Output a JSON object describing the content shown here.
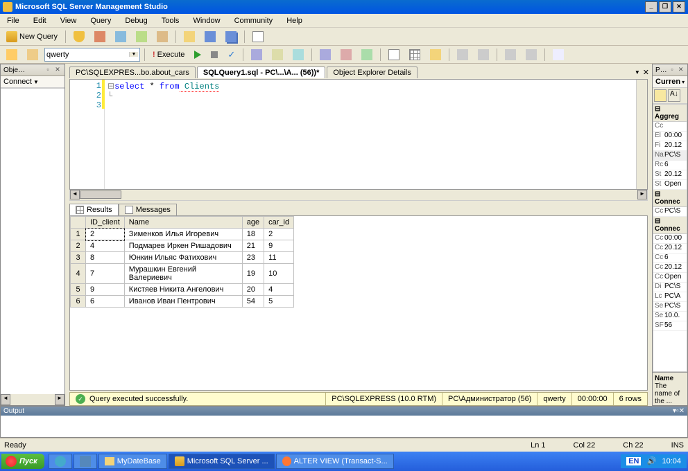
{
  "title": "Microsoft SQL Server Management Studio",
  "menu": [
    "File",
    "Edit",
    "View",
    "Query",
    "Debug",
    "Tools",
    "Window",
    "Community",
    "Help"
  ],
  "toolbar1": {
    "newquery": "New Query"
  },
  "toolbar2": {
    "database": "qwerty",
    "execute": "Execute"
  },
  "leftpanel": {
    "title": "Obje…",
    "connect": "Connect"
  },
  "tabs": [
    "PC\\SQLEXPRES...bo.about_cars",
    "SQLQuery1.sql - PC\\...\\А... (56))*",
    "Object Explorer Details"
  ],
  "sql": {
    "kw1": "select",
    "star": " * ",
    "kw2": "from",
    "tbl": " Clients"
  },
  "resulttabs": {
    "results": "Results",
    "messages": "Messages"
  },
  "columns": [
    "",
    "ID_client",
    "Name",
    "age",
    "car_id"
  ],
  "rows": [
    {
      "n": "1",
      "id": "2",
      "name": "Зименков Илья Игоревич",
      "age": "18",
      "car": "2"
    },
    {
      "n": "2",
      "id": "4",
      "name": "Подмарев Иркен Ришадович",
      "age": "21",
      "car": "9"
    },
    {
      "n": "3",
      "id": "8",
      "name": "Юнкин Ильяс Фатихович",
      "age": "23",
      "car": "11"
    },
    {
      "n": "4",
      "id": "7",
      "name": "Мурашкин Евгений Валериевич",
      "age": "19",
      "car": "10"
    },
    {
      "n": "5",
      "id": "9",
      "name": "Кистяев Никита Ангелович",
      "age": "20",
      "car": "4"
    },
    {
      "n": "6",
      "id": "6",
      "name": "Иванов Иван Пентрович",
      "age": "54",
      "car": "5"
    }
  ],
  "querystatus": {
    "msg": "Query executed successfully.",
    "server": "PC\\SQLEXPRESS (10.0 RTM)",
    "user": "PC\\Администратор (56)",
    "db": "qwerty",
    "time": "00:00:00",
    "rows": "6 rows"
  },
  "rightpanel": {
    "title": "P…",
    "curr": "Curren",
    "aggreg": "Aggreg",
    "agg_rows": [
      {
        "k": "Cc",
        "v": ""
      },
      {
        "k": "El",
        "v": "00:00"
      },
      {
        "k": "Fi",
        "v": "20.12"
      },
      {
        "k": "Na",
        "v": "PC\\S"
      },
      {
        "k": "Rc",
        "v": "6"
      },
      {
        "k": "St",
        "v": "20.12"
      },
      {
        "k": "St",
        "v": "Open"
      }
    ],
    "connec1": "Connec",
    "con1_rows": [
      {
        "k": "Cc",
        "v": "PC\\S"
      }
    ],
    "connec2": "Connec",
    "con2_rows": [
      {
        "k": "Cc",
        "v": "00:00"
      },
      {
        "k": "Cc",
        "v": "20.12"
      },
      {
        "k": "Cc",
        "v": "6"
      },
      {
        "k": "Cc",
        "v": "20.12"
      },
      {
        "k": "Cc",
        "v": "Open"
      },
      {
        "k": "Di",
        "v": "PC\\S"
      },
      {
        "k": "Lc",
        "v": "PC\\А"
      },
      {
        "k": "Se",
        "v": "PC\\S"
      },
      {
        "k": "Se",
        "v": "10.0."
      },
      {
        "k": "SF",
        "v": "56"
      }
    ],
    "desc_title": "Name",
    "desc_text": "The name of the ..."
  },
  "output": {
    "title": "Output"
  },
  "statusbar": {
    "ready": "Ready",
    "ln": "Ln 1",
    "col": "Col 22",
    "ch": "Ch 22",
    "ins": "INS"
  },
  "taskbar": {
    "start": "Пуск",
    "items": [
      {
        "icon": "folder",
        "label": "MyDateBase"
      },
      {
        "icon": "ssms",
        "label": "Microsoft SQL Server ...",
        "active": true
      },
      {
        "icon": "ff",
        "label": "ALTER VIEW (Transact-S..."
      }
    ],
    "lang": "EN",
    "time": "10:04"
  }
}
